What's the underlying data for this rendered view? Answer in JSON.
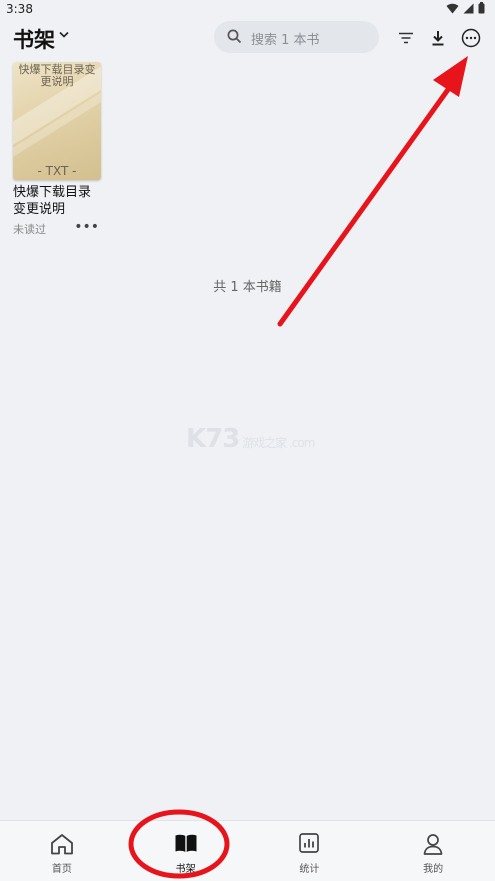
{
  "status": {
    "time": "3:38"
  },
  "header": {
    "title": "书架",
    "search_placeholder": "搜索 1 本书"
  },
  "book": {
    "cover_title": "快爆下载目录变更说明",
    "cover_tag": "- TXT -",
    "name_line1": "快爆下载目录",
    "name_line2": "变更说明",
    "status": "未读过",
    "more": "•••"
  },
  "shelf": {
    "total": "共 1 本书籍"
  },
  "watermark": "K73 游戏之家 .com",
  "nav": {
    "home": "首页",
    "shelf": "书架",
    "stats": "统计",
    "mine": "我的"
  },
  "colors": {
    "annotation": "#e8141c",
    "active_nav": "#111111"
  }
}
